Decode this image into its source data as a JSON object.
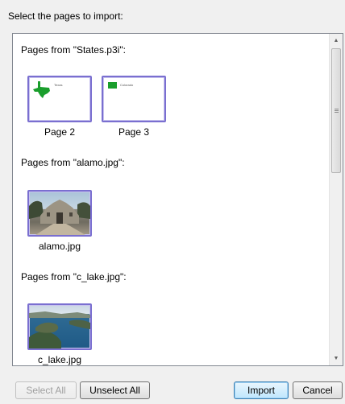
{
  "instruction": "Select the pages to import:",
  "groups": [
    {
      "title": "Pages from \"States.p3i\":",
      "items": [
        {
          "label": "Page 2",
          "page_text": "Texas",
          "selected": true
        },
        {
          "label": "Page 3",
          "page_text": "Colorado",
          "selected": true
        }
      ]
    },
    {
      "title": "Pages from \"alamo.jpg\":",
      "items": [
        {
          "label": "alamo.jpg",
          "selected": true
        }
      ]
    },
    {
      "title": "Pages from \"c_lake.jpg\":",
      "items": [
        {
          "label": "c_lake.jpg",
          "selected": true
        }
      ]
    }
  ],
  "buttons": {
    "select_all": "Select All",
    "unselect_all": "Unselect All",
    "import": "Import",
    "cancel": "Cancel"
  },
  "colors": {
    "selection_border": "#7a6fd0",
    "shape_green": "#1a9e2c"
  }
}
